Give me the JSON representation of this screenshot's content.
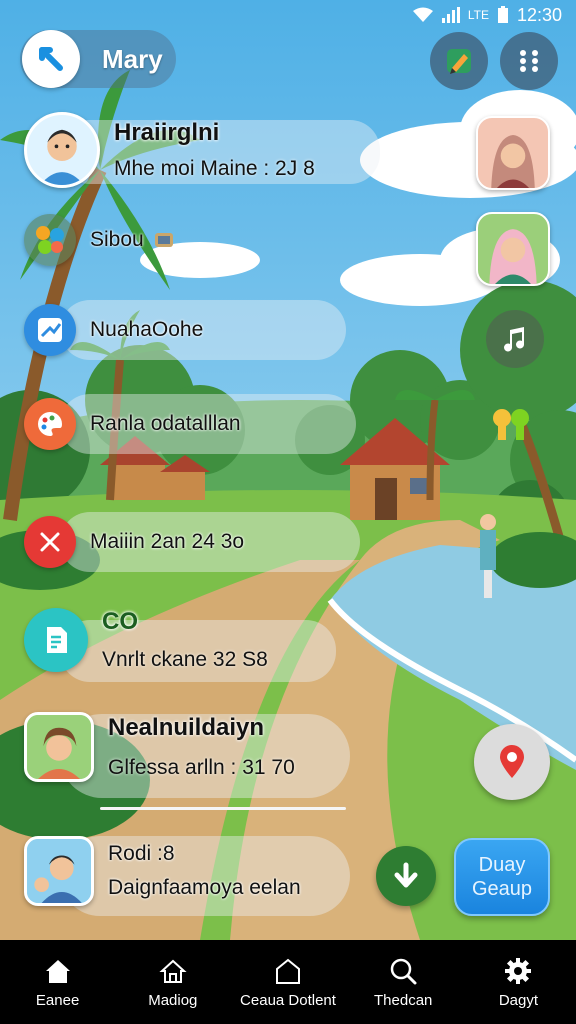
{
  "status": {
    "time": "12:30",
    "carrier": "LTE"
  },
  "topbar": {
    "title": "Mary"
  },
  "rows": [
    {
      "title": "Hraiirglni",
      "subtitle": "Mhe moi Maine : 2J  8"
    },
    {
      "main": "Sibou"
    },
    {
      "main": "NuahaOohe"
    },
    {
      "main": "Ranla odatalllan"
    },
    {
      "main": "Maiiin 2an 24 3o"
    },
    {
      "title": "CO",
      "subtitle": "Vnrlt ckane 32  S8"
    },
    {
      "title": "Nealnuildaiyn",
      "subtitle": "Glfessa arlln : 31 70"
    },
    {
      "title": "Rodi :8",
      "subtitle": "Daignfaamoya eelan"
    }
  ],
  "group_button": {
    "line1": "Duay",
    "line2": "Geaup"
  },
  "nav": [
    {
      "label": "Eanee",
      "icon": "home-icon"
    },
    {
      "label": "Madiog",
      "icon": "home-outline-icon"
    },
    {
      "label": "Ceaua Dotlent",
      "icon": "house-outline-icon"
    },
    {
      "label": "Thedcan",
      "icon": "search-icon"
    },
    {
      "label": "Dagyt",
      "icon": "gear-icon"
    }
  ],
  "colors": {
    "accent": "#1a84de",
    "sky": "#7cc3ea",
    "nav_bg": "#000000"
  }
}
